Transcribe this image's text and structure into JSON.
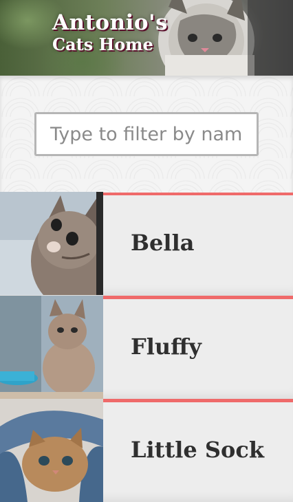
{
  "header": {
    "title_line1": "Antonio's",
    "title_line2": "Cats Home"
  },
  "filter": {
    "placeholder": "Type to filter by name",
    "value": ""
  },
  "cats": [
    {
      "name": "Bella",
      "photo": "kitten-photo"
    },
    {
      "name": "Fluffy",
      "photo": "kitten-photo"
    },
    {
      "name": "Little Sock",
      "photo": "kitten-photo"
    }
  ],
  "colors": {
    "accent": "#ef6a6a",
    "row_background": "#ededed",
    "title_shadow": "#5a0e2a"
  }
}
